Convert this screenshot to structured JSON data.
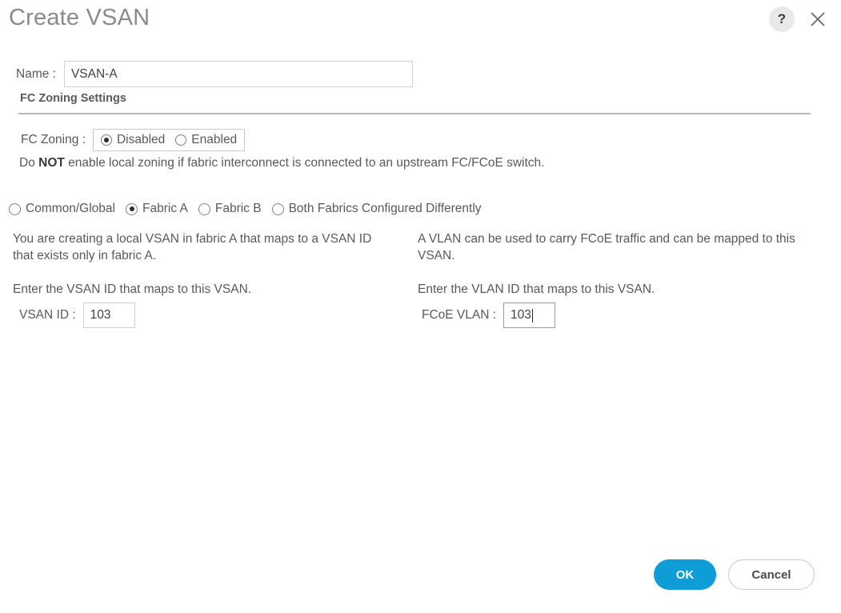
{
  "dialog": {
    "title": "Create VSAN",
    "help_icon_label": "?",
    "help_icon_name": "question-mark-icon",
    "close_icon_name": "close-icon"
  },
  "name_field": {
    "label": "Name :",
    "value": "VSAN-A",
    "placeholder": ""
  },
  "section": {
    "heading": "FC Zoning Settings"
  },
  "fc_zoning": {
    "label": "FC Zoning :",
    "options": [
      {
        "label": "Disabled",
        "selected": true
      },
      {
        "label": "Enabled",
        "selected": false
      }
    ],
    "selected": "Disabled",
    "warning_prefix": "Do ",
    "warning_bold": "NOT",
    "warning_suffix": " enable local zoning if fabric interconnect is connected to an upstream FC/FCoE switch."
  },
  "fabric_scope": {
    "options": [
      {
        "label": "Common/Global",
        "selected": false
      },
      {
        "label": "Fabric A",
        "selected": true
      },
      {
        "label": "Fabric B",
        "selected": false
      },
      {
        "label": "Both Fabrics Configured Differently",
        "selected": false
      }
    ],
    "selected": "Fabric A"
  },
  "left_column": {
    "description": "You are creating a local VSAN in fabric A that maps to a VSAN ID that exists only in fabric A.",
    "instruction": "Enter the VSAN ID that maps to this VSAN.",
    "id_label": "VSAN ID :",
    "id_value": "103"
  },
  "right_column": {
    "description": "A VLAN can be used to carry FCoE traffic and can be mapped to this VSAN.",
    "instruction": "Enter the VLAN ID that maps to this VSAN.",
    "id_label": "FCoE VLAN :",
    "id_value": "103",
    "focused": true
  },
  "footer": {
    "ok_label": "OK",
    "cancel_label": "Cancel"
  },
  "colors": {
    "accent_blue": "#0f9dd8",
    "title_gray": "#8b8b8d",
    "text_gray": "#58595b",
    "border_gray": "#cfd0d2",
    "divider_gray": "#b6b7b9",
    "help_circle_gray": "#e9e9e9"
  }
}
